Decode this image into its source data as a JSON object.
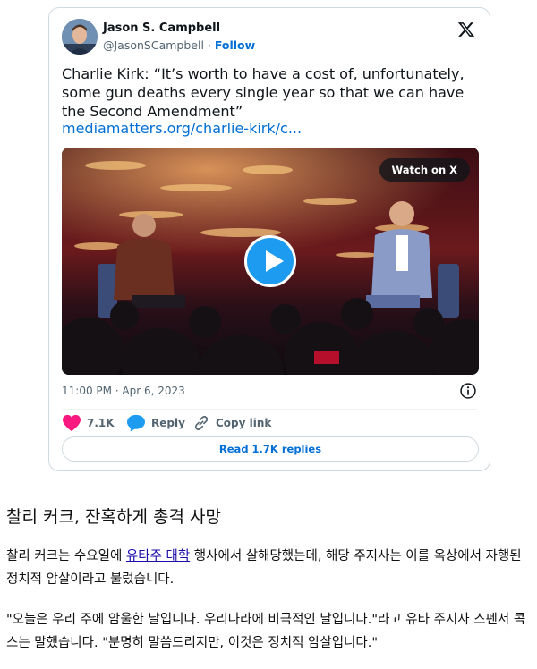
{
  "tweet": {
    "author_name": "Jason S. Campbell",
    "handle": "@JasonSCampbell",
    "separator": " · ",
    "follow_label": "Follow",
    "text": "Charlie Kirk: “It’s worth to have a cost of, unfortunately, some gun deaths every single year so that we can have the Second Amendment”",
    "link_text": "mediamatters.org/charlie-kirk/c...",
    "video": {
      "watch_label": "Watch on X",
      "play_icon": "play-icon"
    },
    "timestamp": "11:00 PM · Apr 6, 2023",
    "likes_count": "7.1K",
    "reply_label": "Reply",
    "copy_link_label": "Copy link",
    "read_replies_label": "Read 1.7K replies",
    "colors": {
      "accent": "#1d9bf0",
      "link": "#006fd6",
      "like": "#f91880",
      "border": "#cfd9de"
    }
  },
  "article": {
    "headline": "찰리 커크, 잔혹하게 총격 사망",
    "para1_before": "찰리 커크는 수요일에 ",
    "para1_link": "유타주 대학",
    "para1_after": " 행사에서 살해당했는데, 해당 주지사는 이를 옥상에서 자행된 정치적 암살이라고 불렀습니다.",
    "para2": "\"오늘은 우리 주에 암울한 날입니다. 우리나라에 비극적인 날입니다.\"라고 유타 주지사 스펜서 콕스는 말했습니다. \"분명히 말씀드리지만, 이것은 정치적 암살입니다.\""
  }
}
